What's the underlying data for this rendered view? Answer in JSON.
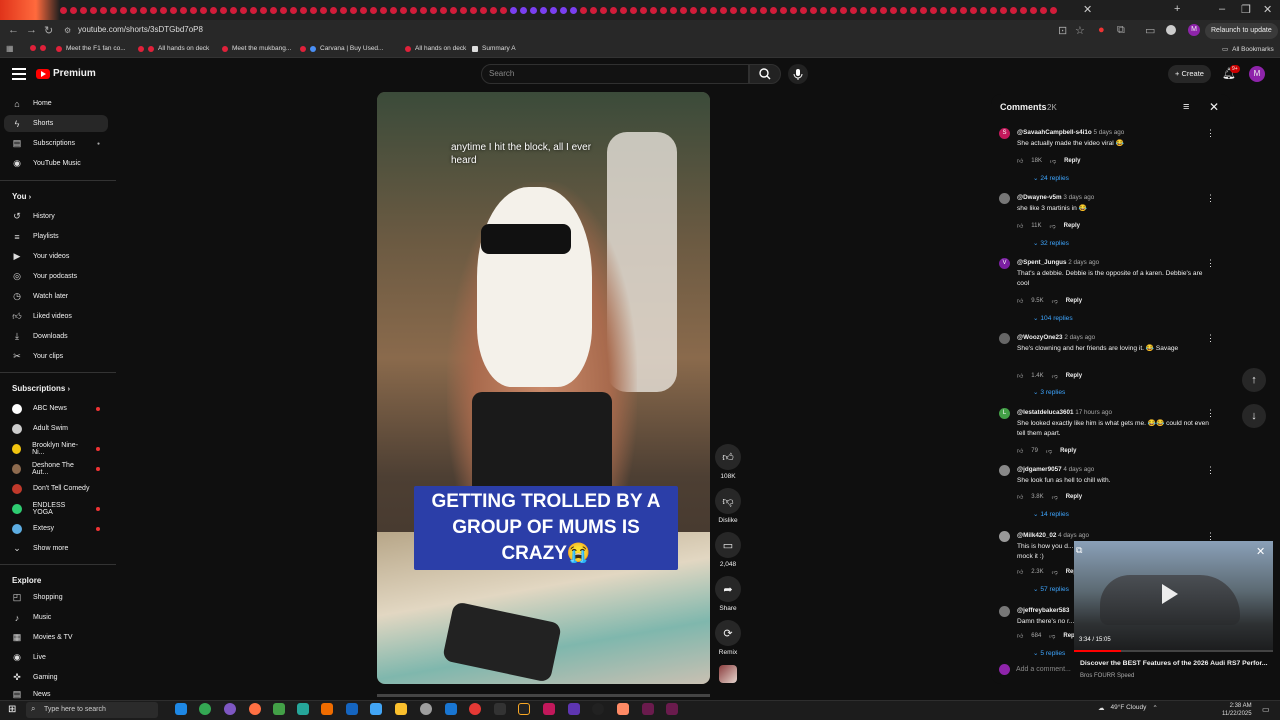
{
  "browser": {
    "url": "youtube.com/shorts/3sDTGbd7oP8",
    "relaunch_label": "Relaunch to update",
    "bookmarks": [
      "Meet the F1 fan co...",
      "All hands on deck",
      "Meet the mukbang...",
      "Carvana | Buy Used...",
      "All hands on deck",
      "Summary A"
    ],
    "all_bookmarks_label": "All Bookmarks",
    "profile_initial": "M"
  },
  "masthead": {
    "logo_text": "Premium",
    "search_placeholder": "Search",
    "create_label": "Create",
    "notif_badge": "9+",
    "avatar_initial": "M"
  },
  "sidebar": {
    "main": [
      {
        "label": "Home",
        "icon": "home-icon"
      },
      {
        "label": "Shorts",
        "icon": "shorts-icon"
      },
      {
        "label": "Subscriptions",
        "icon": "subscriptions-icon"
      },
      {
        "label": "YouTube Music",
        "icon": "music-icon"
      }
    ],
    "you_label": "You",
    "you": [
      {
        "label": "History",
        "icon": "history-icon"
      },
      {
        "label": "Playlists",
        "icon": "playlist-icon"
      },
      {
        "label": "Your videos",
        "icon": "video-icon"
      },
      {
        "label": "Your podcasts",
        "icon": "podcast-icon"
      },
      {
        "label": "Watch later",
        "icon": "clock-icon"
      },
      {
        "label": "Liked videos",
        "icon": "thumb-up-icon"
      },
      {
        "label": "Downloads",
        "icon": "download-icon"
      },
      {
        "label": "Your clips",
        "icon": "scissors-icon"
      }
    ],
    "subscriptions_label": "Subscriptions",
    "subscriptions": [
      {
        "label": "ABC News",
        "color": "#ffffff"
      },
      {
        "label": "Adult Swim",
        "color": "#cccccc"
      },
      {
        "label": "Brooklyn Nine-Ni...",
        "color": "#f1c40f"
      },
      {
        "label": "Deshone The Aut...",
        "color": "#8e6b4f"
      },
      {
        "label": "Don't Tell Comedy",
        "color": "#c0392b"
      },
      {
        "label": "ENDLESS YOGA",
        "color": "#2ecc71"
      },
      {
        "label": "Extesy",
        "color": "#5dade2"
      }
    ],
    "show_more_label": "Show more",
    "explore_label": "Explore",
    "explore": [
      {
        "label": "Shopping",
        "icon": "bag-icon"
      },
      {
        "label": "Music",
        "icon": "music-note-icon"
      },
      {
        "label": "Movies & TV",
        "icon": "film-icon"
      },
      {
        "label": "Live",
        "icon": "live-icon"
      },
      {
        "label": "Gaming",
        "icon": "gamepad-icon"
      },
      {
        "label": "News",
        "icon": "news-icon"
      }
    ]
  },
  "video": {
    "caption_top": "anytime I hit the block, all I ever heard",
    "caption_main": "GETTING TROLLED BY A GROUP OF MUMS IS CRAZY😭"
  },
  "actions": {
    "like_count": "108K",
    "dislike_label": "Dislike",
    "comments_count": "2,048",
    "share_label": "Share",
    "remix_label": "Remix"
  },
  "comments": {
    "title": "Comments",
    "count": "2K",
    "add_placeholder": "Add a comment...",
    "items": [
      {
        "user": "@SavaahCampbell-s4i1o",
        "time": "5 days ago",
        "text": "She actually made the video viral 😂",
        "likes": "18K",
        "reply": "Reply",
        "replies": "24 replies",
        "avatar": "S",
        "color": "#c2185b"
      },
      {
        "user": "@Dwayne-v5m",
        "time": "3 days ago",
        "text": "she like 3 martinis in 😂",
        "likes": "11K",
        "reply": "Reply",
        "replies": "32 replies",
        "avatar": "",
        "color": "#777777"
      },
      {
        "user": "@Spent_Jungus",
        "time": "2 days ago",
        "text": "That's a debbie. Debbie is the opposite of a karen. Debbie's are cool",
        "likes": "9.5K",
        "reply": "Reply",
        "replies": "104 replies",
        "avatar": "V",
        "color": "#7b1fa2"
      },
      {
        "user": "@WoozyOne23",
        "time": "2 days ago",
        "text": "She's clowning and her friends are loving it. 😂 Savage",
        "likes": "1.4K",
        "reply": "Reply",
        "replies": "3 replies",
        "avatar": "",
        "color": "#666666"
      },
      {
        "user": "@lestatdeluca3601",
        "time": "17 hours ago",
        "text": "She looked exactly like him is what gets me. 😂😂 could not even tell them apart.",
        "likes": "79",
        "reply": "Reply",
        "replies": "",
        "avatar": "L",
        "color": "#43a047"
      },
      {
        "user": "@jdgamer9057",
        "time": "4 days ago",
        "text": "She look fun as hell to chill with.",
        "likes": "3.8K",
        "reply": "Reply",
        "replies": "14 replies",
        "avatar": "",
        "color": "#888888"
      },
      {
        "user": "@Milk420_02",
        "time": "4 days ago",
        "text": "This is how you d... you mock it :)",
        "likes": "2.3K",
        "reply": "Reply",
        "replies": "57 replies",
        "avatar": "",
        "color": "#999999"
      },
      {
        "user": "@jeffreybaker583",
        "time": "",
        "text": "Damn there's no r...",
        "likes": "684",
        "reply": "Reply",
        "replies": "5 replies",
        "avatar": "",
        "color": "#777777"
      }
    ]
  },
  "miniplayer": {
    "time": "3:34 / 15:05",
    "progress": 0.237,
    "title": "Discover the BEST Features of the 2026 Audi RS7 Perfor...",
    "channel": "Bros FOURR Speed"
  },
  "taskbar": {
    "search_placeholder": "Type here to search",
    "weather": "49°F  Cloudy",
    "time": "2:38 AM",
    "date": "11/22/2025"
  }
}
